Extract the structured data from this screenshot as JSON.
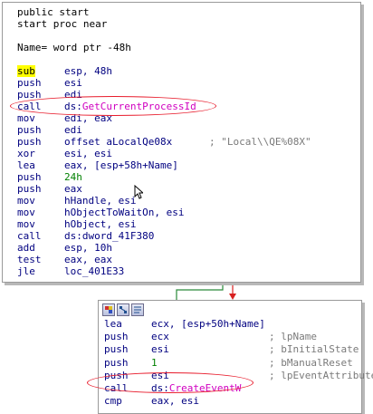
{
  "block1": {
    "lines": [
      {
        "m": "public start",
        "o": "",
        "c": ""
      },
      {
        "m": "start proc near",
        "o": "",
        "c": ""
      },
      {
        "m": "",
        "o": "",
        "c": ""
      },
      {
        "m": "Name= word ptr -48h",
        "o": "",
        "c": ""
      },
      {
        "m": "",
        "o": "",
        "c": ""
      },
      {
        "m": "sub",
        "o": "esp, 48h",
        "c": ""
      },
      {
        "m": "push",
        "o": "esi",
        "c": ""
      },
      {
        "m": "push",
        "o": "edi",
        "c": ""
      },
      {
        "m": "call",
        "o": "ds:",
        "o2": "GetCurrentProcessId",
        "c": ""
      },
      {
        "m": "mov",
        "o": "edi, eax",
        "c": ""
      },
      {
        "m": "push",
        "o": "edi",
        "c": ""
      },
      {
        "m": "push",
        "o": "offset aLocalQe08x",
        "c": "; \"Local\\\\QE%08X\""
      },
      {
        "m": "xor",
        "o": "esi, esi",
        "c": ""
      },
      {
        "m": "lea",
        "o": "eax, [esp+58h+Name]",
        "c": ""
      },
      {
        "m": "push",
        "o": "24h",
        "c": ""
      },
      {
        "m": "push",
        "o": "eax",
        "c": ""
      },
      {
        "m": "mov",
        "o": "hHandle, esi",
        "c": ""
      },
      {
        "m": "mov",
        "o": "hObjectToWaitOn, esi",
        "c": ""
      },
      {
        "m": "mov",
        "o": "hObject, esi",
        "c": ""
      },
      {
        "m": "call",
        "o": "ds:dword_41F380",
        "c": ""
      },
      {
        "m": "add",
        "o": "esp, 10h",
        "c": ""
      },
      {
        "m": "test",
        "o": "eax, eax",
        "c": ""
      },
      {
        "m": "jle",
        "o": "loc_401E33",
        "c": ""
      }
    ]
  },
  "block2": {
    "toolbar_icons": [
      "color-icon",
      "graph-icon",
      "text-view-icon"
    ],
    "lines": [
      {
        "m": "lea",
        "o": "ecx, [esp+50h+Name]",
        "c": ""
      },
      {
        "m": "push",
        "o": "ecx",
        "c": "; lpName"
      },
      {
        "m": "push",
        "o": "esi",
        "c": "; bInitialState"
      },
      {
        "m": "push",
        "o": "1",
        "c": "; bManualReset"
      },
      {
        "m": "push",
        "o": "esi",
        "c": "; lpEventAttributes"
      },
      {
        "m": "call",
        "o": "ds:",
        "o2": "CreateEventW",
        "c": ""
      },
      {
        "m": "cmp",
        "o": "eax, esi",
        "c": ""
      }
    ]
  },
  "colors": {
    "code": "#000080",
    "highlight": "#ffff00",
    "api_name": "#d000c0",
    "ellipse": "#e81c2c",
    "edge_green": "#2a8a3a",
    "edge_red": "#d82020",
    "number": "#008000"
  }
}
